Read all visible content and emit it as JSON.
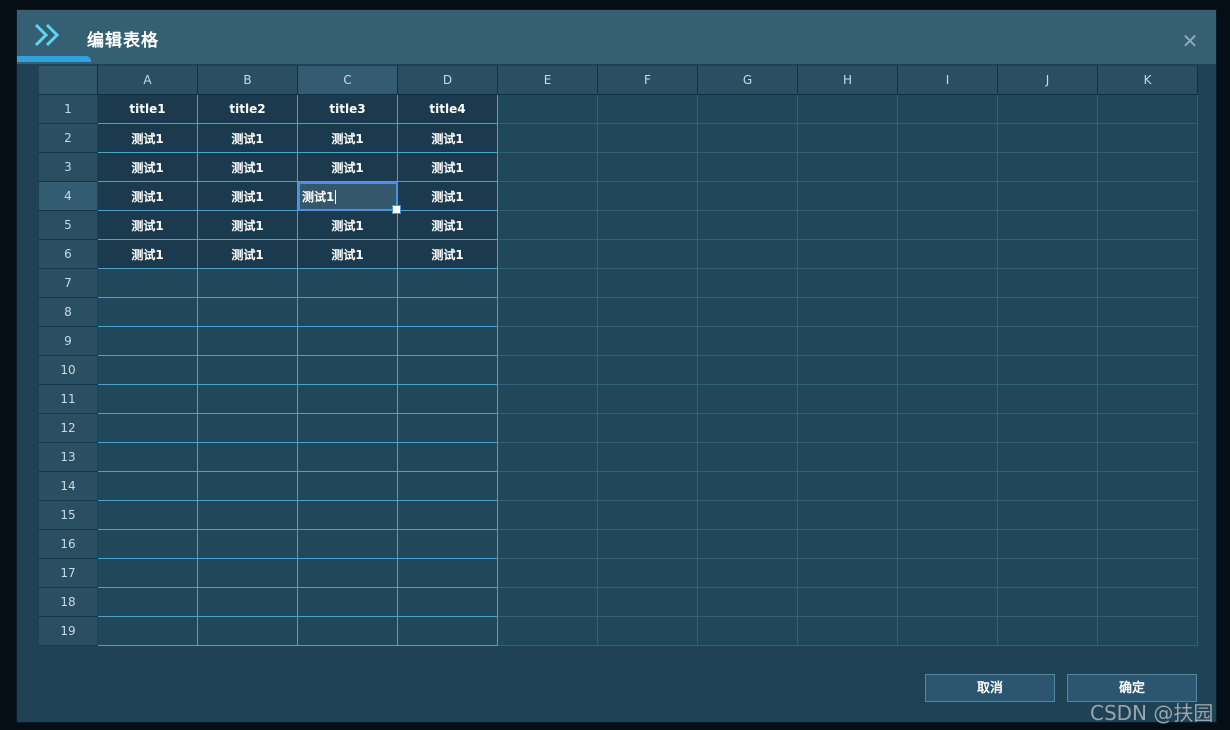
{
  "dialog": {
    "title": "编辑表格",
    "close_icon": "close-icon",
    "header_icon": "double-chevron-right-icon"
  },
  "sheet": {
    "columns": [
      "A",
      "B",
      "C",
      "D",
      "E",
      "F",
      "G",
      "H",
      "I",
      "J",
      "K"
    ],
    "rows": [
      "1",
      "2",
      "3",
      "4",
      "5",
      "6",
      "7",
      "8",
      "9",
      "10",
      "11",
      "12",
      "13",
      "14",
      "15",
      "16",
      "17",
      "18",
      "19"
    ],
    "header_row": [
      "title1",
      "title2",
      "title3",
      "title4"
    ],
    "data_rows": [
      [
        "测试1",
        "测试1",
        "测试1",
        "测试1"
      ],
      [
        "测试1",
        "测试1",
        "测试1",
        "测试1"
      ],
      [
        "测试1",
        "测试1",
        "测试1",
        "测试1"
      ],
      [
        "测试1",
        "测试1",
        "测试1",
        "测试1"
      ],
      [
        "测试1",
        "测试1",
        "测试1",
        "测试1"
      ]
    ],
    "active_cell": "C4",
    "editing_value": "测试1"
  },
  "buttons": {
    "cancel": "取消",
    "ok": "确定"
  },
  "watermark": "CSDN @扶园",
  "colors": {
    "accent": "#2fa3e2",
    "grid_line": "#4aa2cf",
    "dialog_bg": "#1f4257",
    "header_bg": "#356074"
  }
}
